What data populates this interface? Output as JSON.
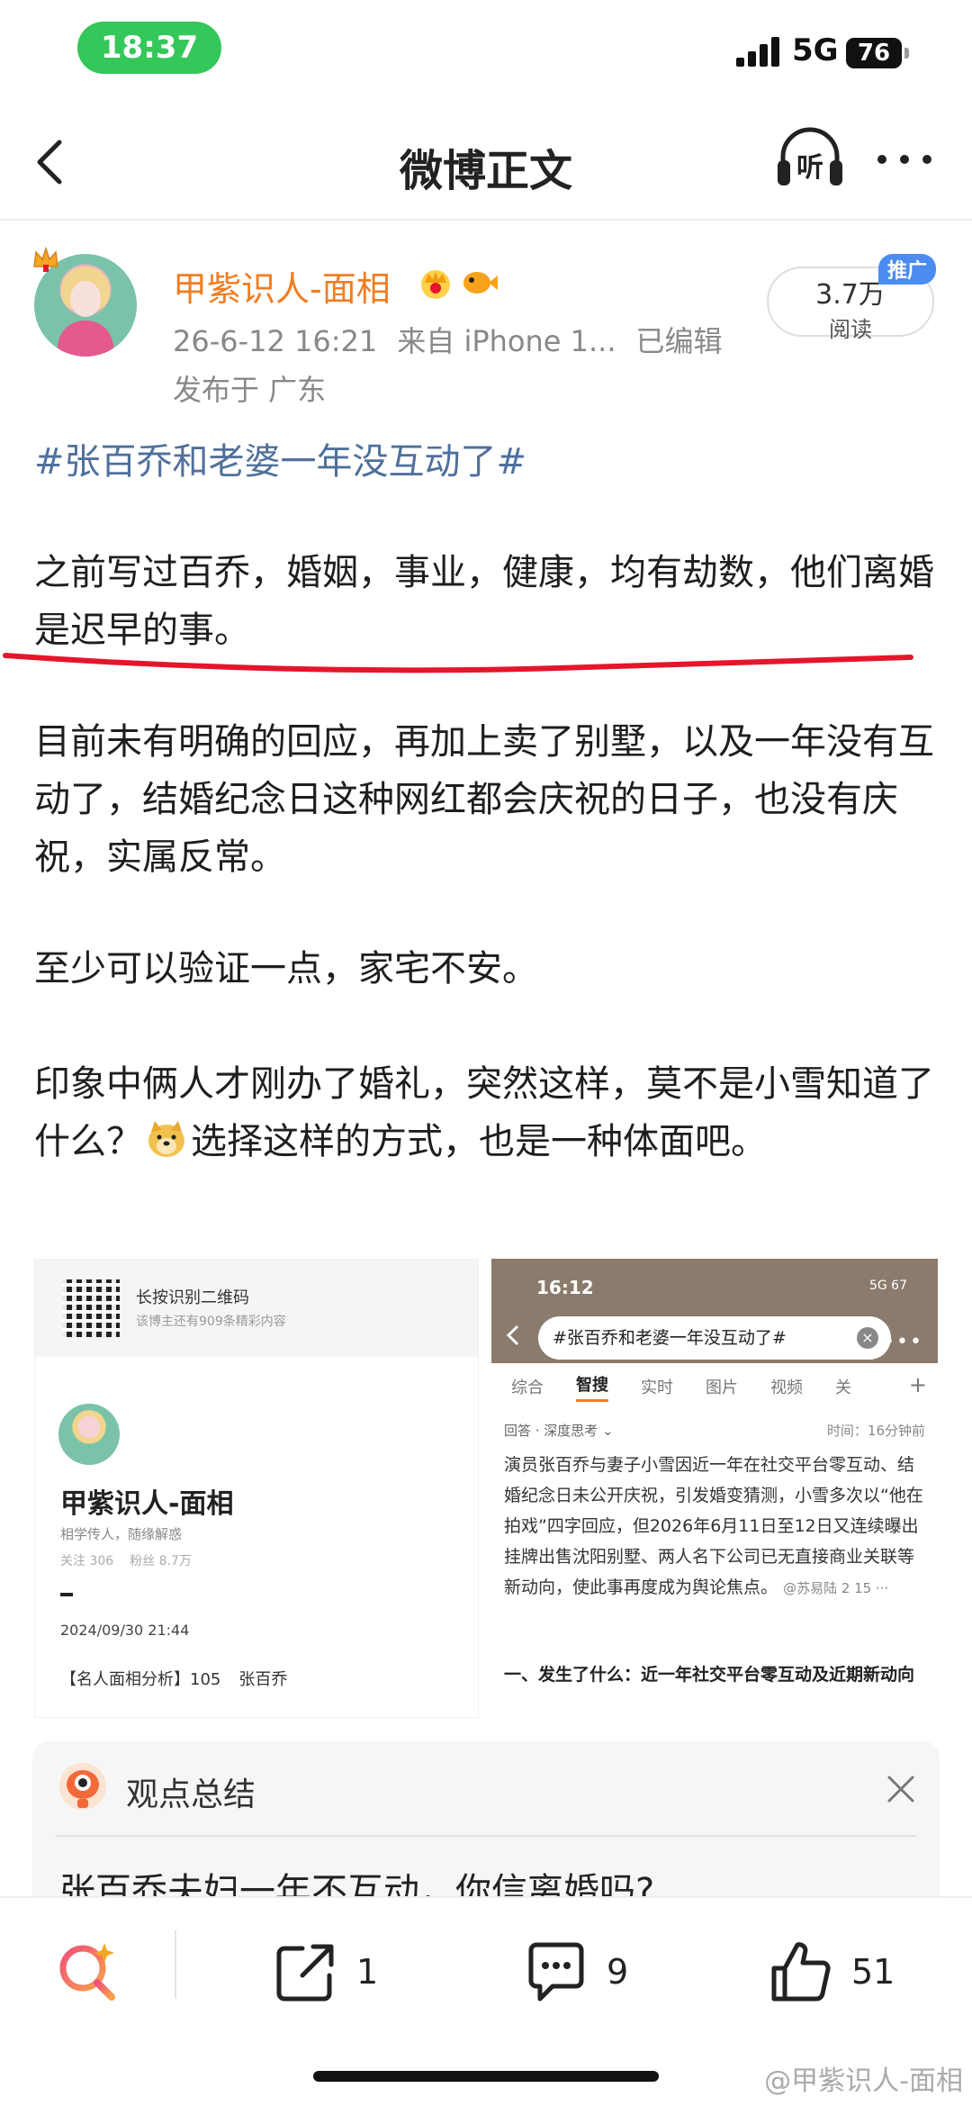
{
  "status_bar": {
    "time": "18:37",
    "network": "5G",
    "battery": "76"
  },
  "nav": {
    "title": "微博正文",
    "listen_label": "听"
  },
  "author": {
    "name": "甲紫识人-面相",
    "date": "26-6-12 16:21",
    "source": "来自 iPhone 1...",
    "edited": "已编辑",
    "location": "发布于 广东"
  },
  "read": {
    "count": "3.7万",
    "label": "阅读",
    "ad_tag": "推广"
  },
  "post": {
    "hashtag": "#张百乔和老婆一年没互动了#",
    "p1": "之前写过百乔，婚姻，事业，健康，均有劫数，他们离婚是迟早的事。",
    "p2": "目前未有明确的回应，再加上卖了别墅，以及一年没有互动了，结婚纪念日这种网红都会庆祝的日子，也没有庆祝，实属反常。",
    "p3": "至少可以验证一点，家宅不安。",
    "p4a": "印象中俩人才刚办了婚礼，突然这样，莫不是小雪知道了什么？",
    "p4b": "选择这样的方式，也是一种体面吧。"
  },
  "image_left": {
    "qr_title": "长按识别二维码",
    "qr_sub": "该博主还有909条精彩内容",
    "profile_name": "甲紫识人-面相",
    "profile_desc": "相学传人，随缘解惑",
    "following": "关注 306",
    "followers": "粉丝 8.7万",
    "date": "2024/09/30 21:44",
    "post_title": "【名人面相分析】105",
    "post_name": "张百乔"
  },
  "image_right": {
    "time": "16:12",
    "status": "5G 67",
    "search_query": "#张百乔和老婆一年没互动了#",
    "tabs": [
      "综合",
      "智搜",
      "实时",
      "图片",
      "视频",
      "关"
    ],
    "answer_label": "回答 · 深度思考 ⌄",
    "answer_time": "时间：16分钟前",
    "answer_text": "演员张百乔与妻子小雪因近一年在社交平台零互动、结婚纪念日未公开庆祝，引发婚变猜测，小雪多次以“他在拍戏”四字回应，但2026年6月11日至12日又连续曝出挂牌出售沈阳别墅、两人名下公司已无直接商业关联等新动向，使此事再度成为舆论焦点。",
    "answer_source": "@苏易陆  2  15  ···",
    "heading": "一、发生了什么：近一年社交平台零互动及近期新动向"
  },
  "summary": {
    "title": "观点总结",
    "question": "张百乔夫妇一年不互动，你信离婚吗?"
  },
  "actions": {
    "share_count": "1",
    "comment_count": "9",
    "like_count": "51"
  },
  "watermark": "@甲紫识人-面相",
  "colors": {
    "brand_orange": "#f07d22",
    "hashtag_blue": "#50709c",
    "underline_red": "#e5162b",
    "time_green": "#34c759"
  }
}
